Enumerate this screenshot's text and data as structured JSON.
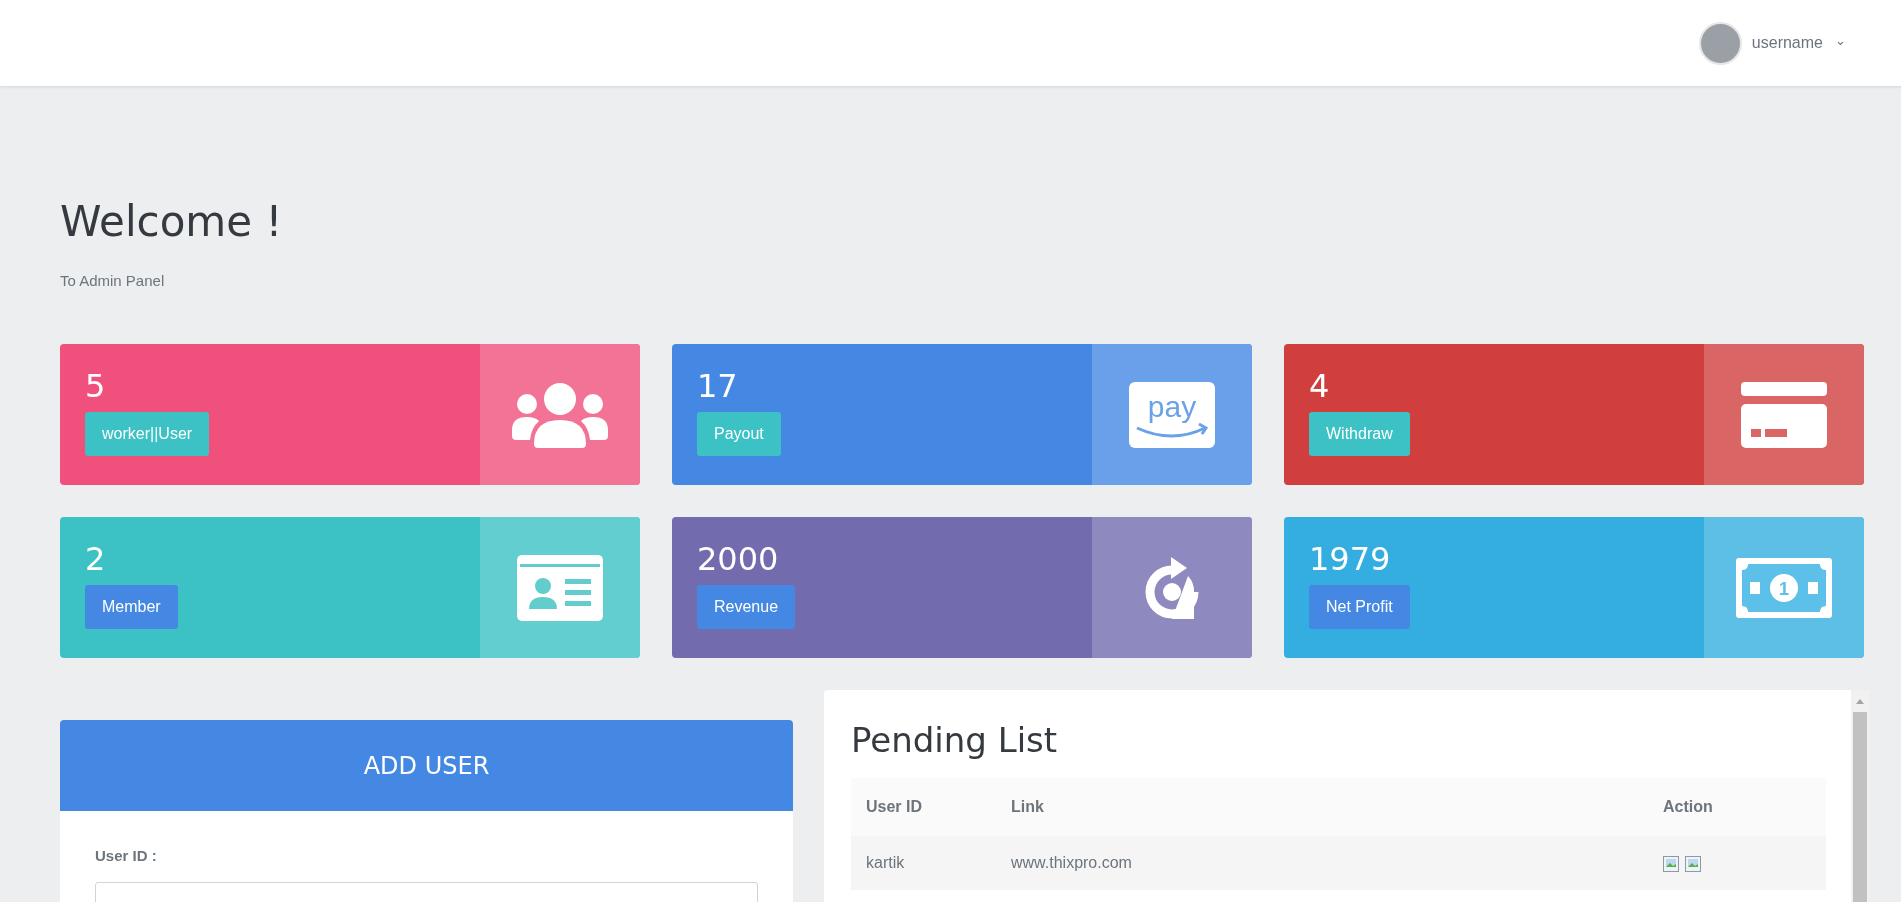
{
  "top_bar": {
    "user_menu": {
      "name": "username",
      "caret": "⌄"
    }
  },
  "header": {
    "title": "Welcome !",
    "subtitle": "To Admin Panel"
  },
  "cards": [
    {
      "value": "5",
      "color": "#f0507c",
      "badge": {
        "label": "worker||User",
        "color": "#3cc2c4"
      }
    },
    {
      "value": "17",
      "color": "#4488e3",
      "icon_text": "pay",
      "badge": {
        "label": "Payout",
        "color": "#3cc2c4"
      }
    },
    {
      "value": "4",
      "color": "#d03e3e",
      "badge": {
        "label": "Withdraw",
        "color": "#3cc2c4"
      }
    },
    {
      "value": "2",
      "color": "#3cc2c4",
      "badge": {
        "label": "Member",
        "color": "#4488e3"
      }
    },
    {
      "value": "2000",
      "color": "#726bae",
      "badge": {
        "label": "Revenue",
        "color": "#4488e3"
      }
    },
    {
      "value": "1979",
      "color": "#34aee0",
      "icon_text": "1",
      "badge": {
        "label": "Net Profit",
        "color": "#4488e3"
      }
    }
  ],
  "add_user": {
    "title": "ADD USER",
    "fields": [
      {
        "label": "User ID :"
      }
    ]
  },
  "pending_list": {
    "title": "Pending List",
    "columns": [
      "User ID",
      "Link",
      "Action"
    ],
    "rows": [
      {
        "user_id": "kartik",
        "link": "www.thixpro.com"
      }
    ]
  }
}
